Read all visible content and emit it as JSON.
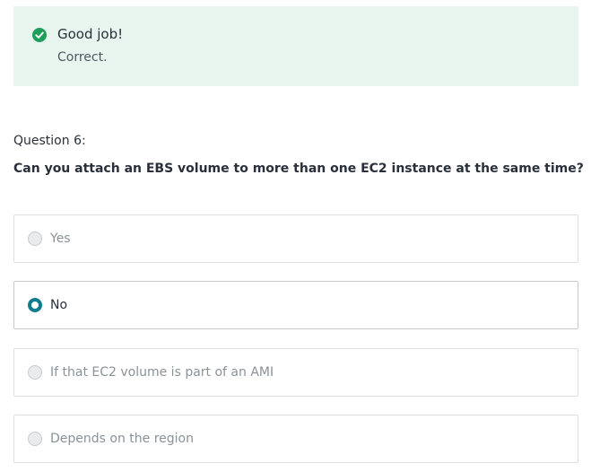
{
  "feedback": {
    "title": "Good job!",
    "message": "Correct.",
    "status_color": "#1e9e5a",
    "icon": "check-circle-icon"
  },
  "question": {
    "label": "Question 6:",
    "text": "Can you attach an EBS volume to more than one EC2 instance at the same time?"
  },
  "options": [
    {
      "label": "Yes",
      "selected": false
    },
    {
      "label": "No",
      "selected": true
    },
    {
      "label": "If that EC2 volume is part of an AMI",
      "selected": false
    },
    {
      "label": "Depends on the region",
      "selected": false
    }
  ],
  "accent_color": "#0f7c90"
}
